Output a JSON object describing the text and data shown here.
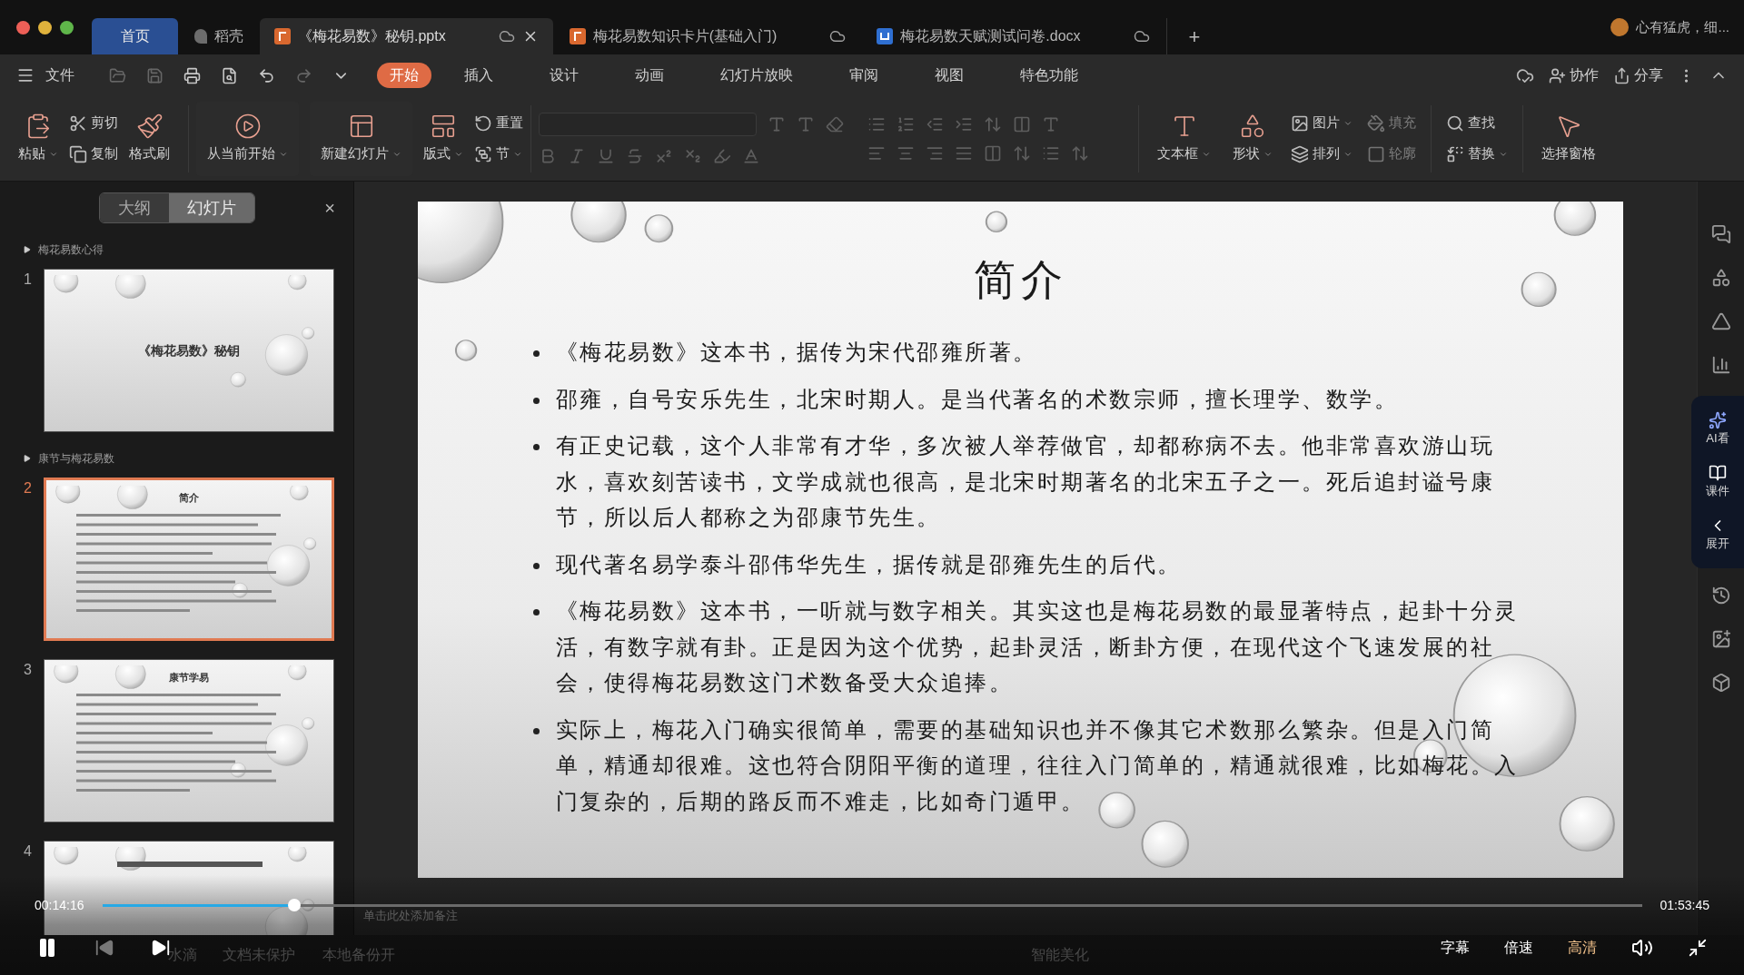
{
  "tabs": [
    {
      "label": "首页",
      "kind": "home",
      "selected": false,
      "closable": false,
      "cloud": false
    },
    {
      "label": "稻壳",
      "kind": "daoke",
      "selected": false,
      "closable": false,
      "cloud": false
    },
    {
      "label": "《梅花易数》秘钥.pptx",
      "kind": "pptx",
      "selected": true,
      "closable": true,
      "cloud": true
    },
    {
      "label": "梅花易数知识卡片(基础入门)",
      "kind": "pptx",
      "selected": false,
      "closable": false,
      "cloud": true
    },
    {
      "label": "梅花易数天赋测试问卷.docx",
      "kind": "docx",
      "selected": false,
      "closable": false,
      "cloud": true
    }
  ],
  "new_tab": "+",
  "user": "心有猛虎，细...",
  "menu": [
    {
      "label": "开始",
      "selected": true
    },
    {
      "label": "插入",
      "selected": false
    },
    {
      "label": "设计",
      "selected": false
    },
    {
      "label": "动画",
      "selected": false
    },
    {
      "label": "幻灯片放映",
      "selected": false
    },
    {
      "label": "审阅",
      "selected": false
    },
    {
      "label": "视图",
      "selected": false
    },
    {
      "label": "特色功能",
      "selected": false
    }
  ],
  "file_menu": "文件",
  "collab": "协作",
  "share": "分享",
  "ribbon": {
    "paste": "粘贴",
    "cut": "剪切",
    "copy": "复制",
    "format_painter": "格式刷",
    "play_current": "从当前开始",
    "new_slide": "新建幻灯片",
    "layout": "版式",
    "reset": "重置",
    "section": "节",
    "text_box": "文本框",
    "shape": "形状",
    "picture": "图片",
    "arrange": "排列",
    "fill": "填充",
    "outline": "轮廓",
    "find": "查找",
    "replace": "替换",
    "selection_pane": "选择窗格"
  },
  "panel": {
    "tabs": [
      {
        "label": "大纲",
        "selected": false
      },
      {
        "label": "幻灯片",
        "selected": true
      }
    ],
    "close": "×",
    "sections": [
      {
        "title": "梅花易数心得",
        "slides": [
          {
            "number": "1",
            "title": "《梅花易数》秘钥",
            "kind": "title",
            "selected": false
          }
        ]
      },
      {
        "title": "康节与梅花易数",
        "slides": [
          {
            "number": "2",
            "title": "简介",
            "kind": "content",
            "selected": true
          },
          {
            "number": "3",
            "title": "康节学易",
            "kind": "content",
            "selected": false
          },
          {
            "number": "4",
            "kind": "cut",
            "selected": false
          }
        ]
      }
    ]
  },
  "slide": {
    "title": "简介",
    "bullets": [
      "《梅花易数》这本书，据传为宋代邵雍所著。",
      "邵雍，自号安乐先生，北宋时期人。是当代著名的术数宗师，擅长理学、数学。",
      "有正史记载，这个人非常有才华，多次被人举荐做官，却都称病不去。他非常喜欢游山玩水，喜欢刻苦读书，文学成就也很高，是北宋时期著名的北宋五子之一。死后追封谥号康节，所以后人都称之为邵康节先生。",
      "现代著名易学泰斗邵伟华先生，据传就是邵雍先生的后代。",
      "《梅花易数》这本书，一听就与数字相关。其实这也是梅花易数的最显著特点，起卦十分灵活，有数字就有卦。正是因为这个优势，起卦灵活，断卦方便，在现代这个飞速发展的社会，使得梅花易数这门术数备受大众追捧。",
      "实际上，梅花入门确实很简单，需要的基础知识也并不像其它术数那么繁杂。但是入门简单，精通却很难。这也符合阴阳平衡的道理，往往入门简单的，精通就很难，比如梅花。入门复杂的，后期的路反而不难走，比如奇门遁甲。"
    ]
  },
  "notes_placeholder": "单击此处添加备注",
  "status_bar": {
    "theme": "水滴",
    "protection": "文档未保护",
    "backup": "本地备份开",
    "beautify": "智能美化"
  },
  "side_panel": [
    {
      "label": "AI看",
      "kind": "ai"
    },
    {
      "label": "课件",
      "kind": "courseware"
    },
    {
      "label": "展开",
      "kind": "expand"
    }
  ],
  "player": {
    "elapsed": "00:14:16",
    "total": "01:53:45",
    "level": 0.125,
    "playing": true,
    "buttons": [
      {
        "label": "字幕",
        "selected": false
      },
      {
        "label": "倍速",
        "selected": false
      },
      {
        "label": "高清",
        "selected": true
      }
    ]
  }
}
